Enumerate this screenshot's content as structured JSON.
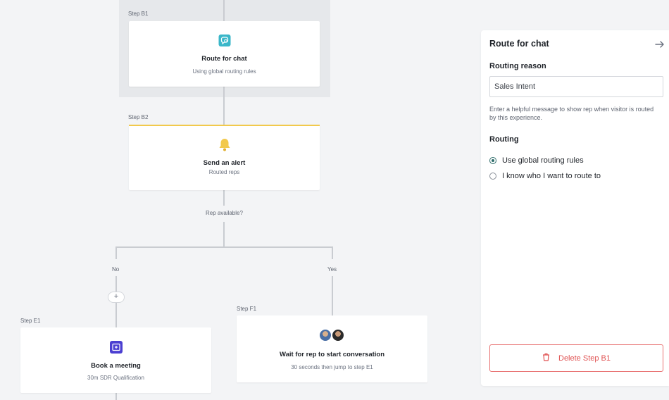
{
  "flow": {
    "b1": {
      "step_label": "Step B1",
      "title": "Route for chat",
      "subtitle": "Using global routing rules",
      "icon": "chat-route-icon",
      "icon_color": "#3bb7c9"
    },
    "b2": {
      "step_label": "Step B2",
      "title": "Send an alert",
      "subtitle": "Routed reps",
      "icon": "bell-icon",
      "icon_color": "#f2c94c",
      "accent": "#f2c94c"
    },
    "condition": "Rep available?",
    "branch_no": "No",
    "branch_yes": "Yes",
    "add_button": "+",
    "e1": {
      "step_label": "Step E1",
      "title": "Book a meeting",
      "subtitle": "30m SDR Qualification",
      "icon": "calendar-icon",
      "icon_color": "#4b3fd1"
    },
    "f1": {
      "step_label": "Step F1",
      "title": "Wait for rep to start conversation",
      "subtitle": "30 seconds then jump to step E1",
      "icon": "rep-avatars"
    }
  },
  "panel": {
    "title": "Route for chat",
    "routing_reason_label": "Routing reason",
    "routing_reason_value": "Sales Intent",
    "helper_text": "Enter a helpful message to show rep when visitor is routed by this experience.",
    "routing_label": "Routing",
    "options": [
      {
        "label": "Use global routing rules",
        "selected": true
      },
      {
        "label": "I know who I want to route to",
        "selected": false
      }
    ],
    "delete_label": "Delete Step B1",
    "danger_color": "#e05252"
  }
}
